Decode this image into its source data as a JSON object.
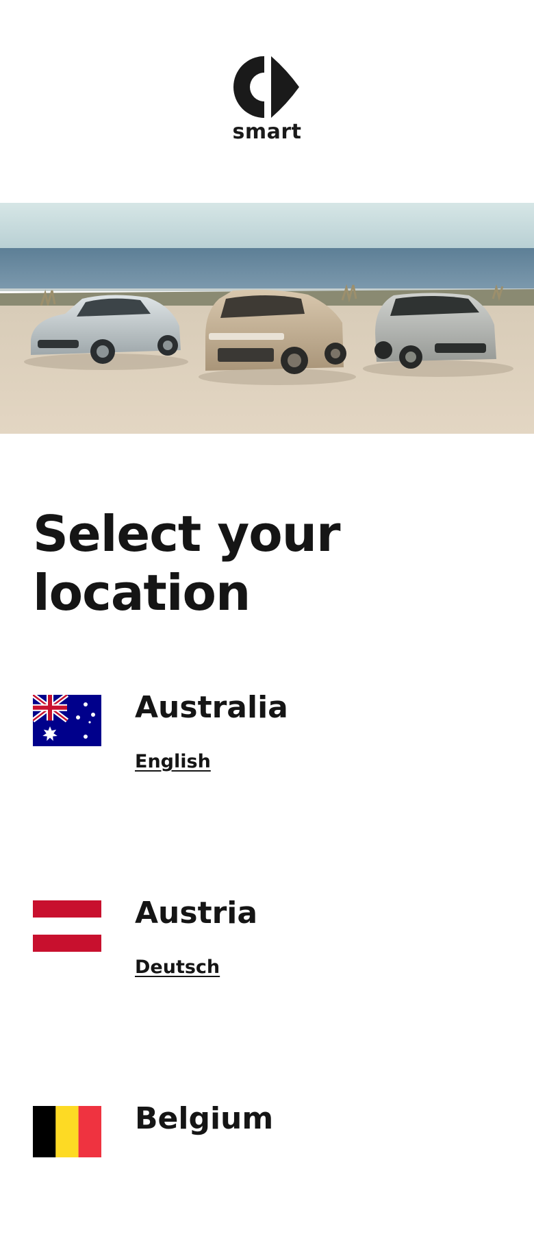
{
  "brand": {
    "logo_text": "smart"
  },
  "hero": {
    "image": "three-smart-cars-by-the-sea"
  },
  "page": {
    "title": "Select your location"
  },
  "countries": [
    {
      "name": "Australia",
      "flag": "australia-flag",
      "languages": [
        "English"
      ]
    },
    {
      "name": "Austria",
      "flag": "austria-flag",
      "languages": [
        "Deutsch"
      ]
    },
    {
      "name": "Belgium",
      "flag": "belgium-flag",
      "languages": []
    }
  ],
  "colors": {
    "text": "#151515",
    "background": "#ffffff",
    "austria_red": "#c8102e",
    "australia_blue": "#00008b",
    "belgium_yellow": "#fdda24",
    "belgium_red": "#ef3340"
  }
}
